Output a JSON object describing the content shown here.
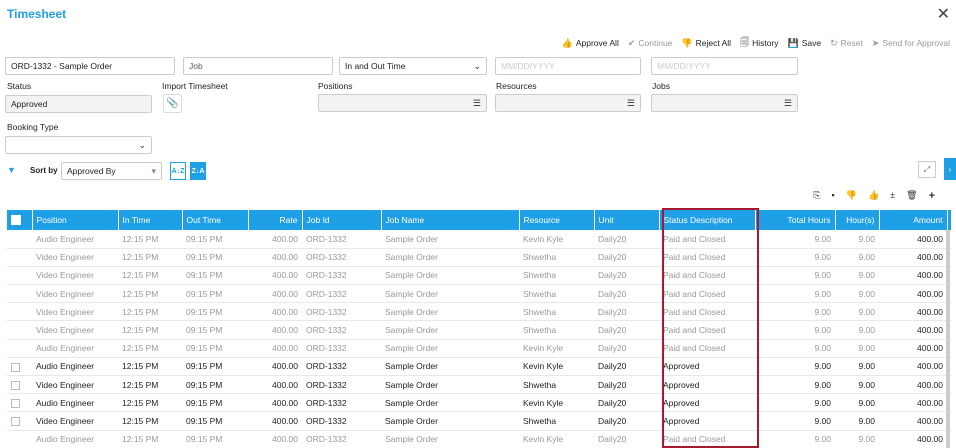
{
  "window": {
    "title": "Timesheet"
  },
  "toolbar": [
    {
      "id": "approve-all",
      "icon": "👍",
      "label": "Approve All",
      "disabled": false
    },
    {
      "id": "continue",
      "icon": "✔",
      "label": "Continue",
      "disabled": true
    },
    {
      "id": "reject-all",
      "icon": "👎",
      "label": "Reject All",
      "disabled": false
    },
    {
      "id": "history",
      "icon": "🗐",
      "label": "History",
      "disabled": false
    },
    {
      "id": "save",
      "icon": "💾",
      "label": "Save",
      "disabled": false
    },
    {
      "id": "reset",
      "icon": "↻",
      "label": "Reset",
      "disabled": true
    },
    {
      "id": "send-approval",
      "icon": "➤",
      "label": "Send for Approval",
      "disabled": true
    }
  ],
  "filters": {
    "order": "ORD-1332 - Sample Order",
    "job_placeholder": "Job",
    "time_type": "In and Out Time",
    "date_from_placeholder": "MM/DD/YYYY",
    "date_to_placeholder": "MM/DD/YYYY",
    "status_label": "Status",
    "status_value": "Approved",
    "import_label": "Import Timesheet",
    "positions_label": "Positions",
    "resources_label": "Resources",
    "jobs_label": "Jobs",
    "booking_type_label": "Booking Type"
  },
  "sort": {
    "label": "Sort by",
    "value": "Approved By",
    "asc": "A↓Z",
    "desc": "Z↓A"
  },
  "columns": [
    "Position",
    "In Time",
    "Out Time",
    "Rate",
    "Job Id",
    "Job Name",
    "Resource",
    "Unit",
    "Status Description",
    "Total Hours",
    "Hour(s)",
    "Amount"
  ],
  "rows": [
    [
      "Audio Engineer",
      "12:15 PM",
      "09:15 PM",
      "400.00",
      "ORD-1332",
      "Sample Order",
      "Kevin Kyle",
      "Daily20",
      "Paid and Closed",
      "9.00",
      "9.00",
      "400.00"
    ],
    [
      "Video Engineer",
      "12:15 PM",
      "09:15 PM",
      "400.00",
      "ORD-1332",
      "Sample Order",
      "Shwetha",
      "Daily20",
      "Paid and Closed",
      "9.00",
      "9.00",
      "400.00"
    ],
    [
      "Video Engineer",
      "12:15 PM",
      "09:15 PM",
      "400.00",
      "ORD-1332",
      "Sample Order",
      "Shwetha",
      "Daily20",
      "Paid and Closed",
      "9.00",
      "9.00",
      "400.00"
    ],
    [
      "Video Engineer",
      "12:15 PM",
      "09:15 PM",
      "400.00",
      "ORD-1332",
      "Sample Order",
      "Shwetha",
      "Daily20",
      "Paid and Closed",
      "9.00",
      "9.00",
      "400.00"
    ],
    [
      "Video Engineer",
      "12:15 PM",
      "09:15 PM",
      "400.00",
      "ORD-1332",
      "Sample Order",
      "Shwetha",
      "Daily20",
      "Paid and Closed",
      "9.00",
      "9.00",
      "400.00"
    ],
    [
      "Video Engineer",
      "12:15 PM",
      "09:15 PM",
      "400.00",
      "ORD-1332",
      "Sample Order",
      "Shwetha",
      "Daily20",
      "Paid and Closed",
      "9.00",
      "9.00",
      "400.00"
    ],
    [
      "Audio Engineer",
      "12:15 PM",
      "09:15 PM",
      "400.00",
      "ORD-1332",
      "Sample Order",
      "Kevin Kyle",
      "Daily20",
      "Paid and Closed",
      "9.00",
      "9.00",
      "400.00"
    ],
    [
      "Audio Engineer",
      "12:15 PM",
      "09:15 PM",
      "400.00",
      "ORD-1332",
      "Sample Order",
      "Kevin Kyle",
      "Daily20",
      "Approved",
      "9.00",
      "9.00",
      "400.00"
    ],
    [
      "Video Engineer",
      "12:15 PM",
      "09:15 PM",
      "400.00",
      "ORD-1332",
      "Sample Order",
      "Shwetha",
      "Daily20",
      "Approved",
      "9.00",
      "9.00",
      "400.00"
    ],
    [
      "Audio Engineer",
      "12:15 PM",
      "09:15 PM",
      "400.00",
      "ORD-1332",
      "Sample Order",
      "Kevin Kyle",
      "Daily20",
      "Approved",
      "9.00",
      "9.00",
      "400.00"
    ],
    [
      "Video Engineer",
      "12:15 PM",
      "09:15 PM",
      "400.00",
      "ORD-1332",
      "Sample Order",
      "Shwetha",
      "Daily20",
      "Approved",
      "9.00",
      "9.00",
      "400.00"
    ],
    [
      "Audio Engineer",
      "12:15 PM",
      "09:15 PM",
      "400.00",
      "ORD-1332",
      "Sample Order",
      "Kevin Kyle",
      "Daily20",
      "Paid and Closed",
      "9.00",
      "9.00",
      "400.00"
    ]
  ],
  "row_selectable": [
    false,
    false,
    false,
    false,
    false,
    false,
    false,
    true,
    true,
    true,
    true,
    false
  ],
  "colors": {
    "accent": "#1f9fe6",
    "highlight": "#a6192e"
  }
}
